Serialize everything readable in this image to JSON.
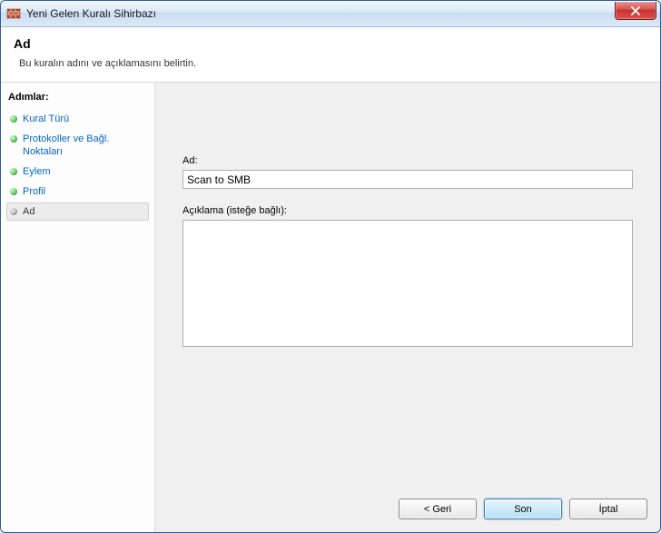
{
  "window": {
    "title": "Yeni Gelen Kuralı Sihirbazı"
  },
  "header": {
    "title": "Ad",
    "subtitle": "Bu kuralın adını ve açıklamasını belirtin."
  },
  "sidebar": {
    "steps_label": "Adımlar:",
    "items": [
      {
        "label": "Kural Türü"
      },
      {
        "label": "Protokoller ve Bağl. Noktaları"
      },
      {
        "label": "Eylem"
      },
      {
        "label": "Profil"
      },
      {
        "label": "Ad"
      }
    ]
  },
  "form": {
    "name_label": "Ad:",
    "name_value": "Scan to SMB",
    "description_label": "Açıklama (isteğe bağlı):",
    "description_value": ""
  },
  "buttons": {
    "back": "< Geri",
    "next": "Son",
    "cancel": "İptal"
  }
}
